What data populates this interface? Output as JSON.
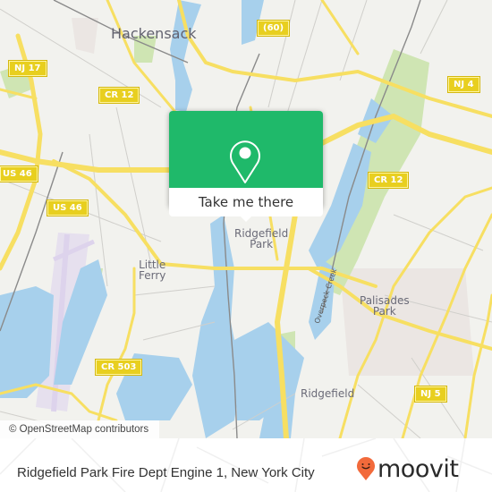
{
  "map": {
    "places": [
      {
        "id": "hackensack",
        "label": "Hackensack"
      },
      {
        "id": "little-ferry",
        "label": "Little\nFerry"
      },
      {
        "id": "ridgefield-park",
        "label": "Ridgefield\nPark"
      },
      {
        "id": "palisades-park",
        "label": "Palisades\nPark"
      },
      {
        "id": "ridgefield",
        "label": "Ridgefield"
      }
    ],
    "shields": [
      {
        "id": "nj-17",
        "label": "NJ 17"
      },
      {
        "id": "cr-12-west",
        "label": "CR 12"
      },
      {
        "id": "route-60",
        "label": "(60)"
      },
      {
        "id": "nj-4",
        "label": "NJ 4"
      },
      {
        "id": "us-46-a",
        "label": "US 46"
      },
      {
        "id": "us-46-b",
        "label": "US 46"
      },
      {
        "id": "cr-12-east",
        "label": "CR 12"
      },
      {
        "id": "cr-503",
        "label": "CR 503"
      },
      {
        "id": "nj-5",
        "label": "NJ 5"
      }
    ],
    "waterways": [
      {
        "id": "overpeck-creek",
        "label": "Overpeck Creek"
      }
    ],
    "attribution": "© OpenStreetMap contributors"
  },
  "popup": {
    "icon": "map-pin-icon",
    "action_label": "Take me there",
    "color": "#1fb96a"
  },
  "footer": {
    "title": "Ridgefield Park Fire Dept Engine 1, New York City",
    "brand": "moovit",
    "brand_color": "#f26a3b"
  }
}
